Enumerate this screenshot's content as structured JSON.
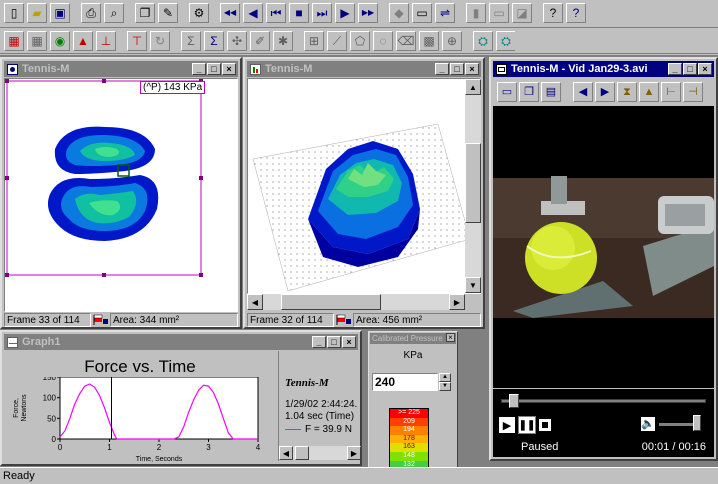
{
  "toolbar1": {
    "icons": [
      "new-file-icon",
      "open-folder-icon",
      "save-icon",
      "print-icon",
      "print-preview-icon",
      "copy-icon",
      "edit-icon",
      "settings-icon",
      "rewind-icon",
      "step-back-icon",
      "first-frame-icon",
      "stop-icon",
      "last-frame-icon",
      "play-icon",
      "fast-forward-icon",
      "marker-icon",
      "record-icon",
      "loop-icon",
      "layout-1-icon",
      "layout-2-icon",
      "layout-3-icon",
      "help-icon",
      "context-help-icon"
    ]
  },
  "toolbar2": {
    "icons": [
      "color-map-icon",
      "grid-icon",
      "contour-icon",
      "peak-icon",
      "force-icon",
      "center-icon",
      "rotate-icon",
      "sum-1-icon",
      "sum-2-icon",
      "region-icon",
      "brush-icon",
      "cursor-icon",
      "box-select-icon",
      "line-icon",
      "polygon-icon",
      "lasso-icon",
      "erase-icon",
      "fill-icon",
      "zoom-icon",
      "camera-1-icon",
      "camera-2-icon",
      "camera-3-icon"
    ]
  },
  "window_2d": {
    "title": "Tennis-M",
    "readout": "(^P) 143 KPa",
    "frame": "Frame 33 of 114",
    "area": "Area: 344 mm²"
  },
  "window_3d": {
    "title": "Tennis-M",
    "frame": "Frame 32 of 114",
    "area": "Area: 456 mm²"
  },
  "window_video": {
    "title": "Tennis-M - Vid Jan29-3.avi",
    "status": "Paused",
    "time": "00:01 / 00:16"
  },
  "graph": {
    "title": "Graph1",
    "chart_title": "Force vs. Time",
    "legend_title": "Tennis-M",
    "legend_date": "1/29/02 2:44:24.",
    "legend_time": "1.04 sec (Time)",
    "legend_series": "F = 39.9 N"
  },
  "chart_data": {
    "type": "line",
    "title": "Force vs. Time",
    "xlabel": "Time, Seconds",
    "ylabel": "Force, Newtons",
    "xlim": [
      0,
      4
    ],
    "ylim": [
      0,
      150
    ],
    "xticks": [
      "0",
      "1",
      "2",
      "3",
      "4"
    ],
    "yticks": [
      "0",
      "50",
      "100",
      "150"
    ],
    "cursor_x": 1.04,
    "series": [
      {
        "name": "F = 39.9 N",
        "x": [
          0.0,
          0.1,
          0.2,
          0.3,
          0.4,
          0.5,
          0.6,
          0.7,
          0.8,
          0.9,
          1.0,
          1.1,
          1.15,
          1.2,
          1.3,
          1.4,
          1.5,
          1.6,
          1.7,
          1.8,
          1.9,
          2.0,
          2.1,
          2.2,
          2.3,
          2.4,
          2.5,
          2.6,
          2.7,
          2.8,
          2.9,
          3.0,
          3.1,
          3.2,
          3.3,
          3.4,
          3.5,
          3.6,
          3.7,
          3.8,
          3.9,
          4.0
        ],
        "y": [
          5,
          20,
          50,
          85,
          110,
          128,
          133,
          125,
          105,
          75,
          40,
          10,
          0,
          0,
          0,
          0,
          0,
          0,
          0,
          0,
          0,
          0,
          0,
          0,
          0,
          5,
          30,
          65,
          95,
          118,
          130,
          128,
          112,
          85,
          50,
          15,
          0,
          0,
          0,
          0,
          0,
          0
        ],
        "color": "#ff00ff"
      }
    ]
  },
  "pressure_panel": {
    "title": "Calibrated Pressure",
    "unit": "KPa",
    "value": "240",
    "scale": [
      {
        "label": ">= 225",
        "color": "#ff0000"
      },
      {
        "label": "209",
        "color": "#ff4000"
      },
      {
        "label": "194",
        "color": "#ff8000"
      },
      {
        "label": "178",
        "color": "#ffb000"
      },
      {
        "label": "163",
        "color": "#e0e000"
      },
      {
        "label": "148",
        "color": "#80e000"
      },
      {
        "label": "132",
        "color": "#40d040"
      }
    ]
  },
  "statusbar": {
    "text": "Ready"
  }
}
